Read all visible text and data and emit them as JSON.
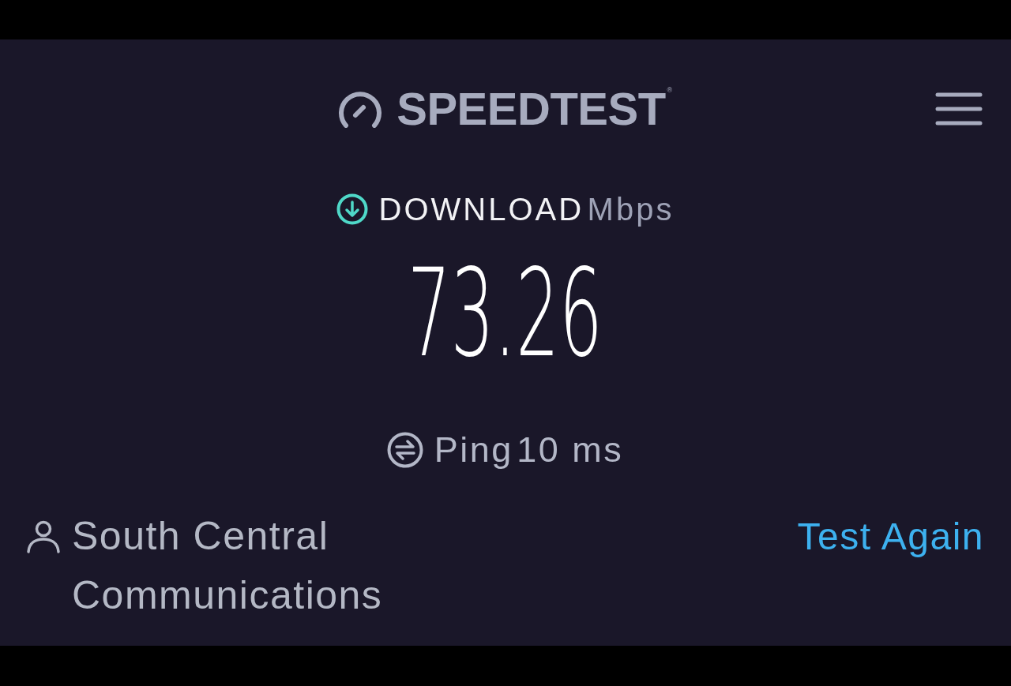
{
  "header": {
    "logo_text": "SPEEDTEST$^{®}$"
  },
  "result": {
    "metric": "DOWNLOAD",
    "unit": "Mbps",
    "value": "73.26"
  },
  "ping": {
    "label": "Ping",
    "value": "10 ms"
  },
  "provider": {
    "name": "South Central Communications"
  },
  "actions": {
    "test_again": "Test Again"
  }
}
